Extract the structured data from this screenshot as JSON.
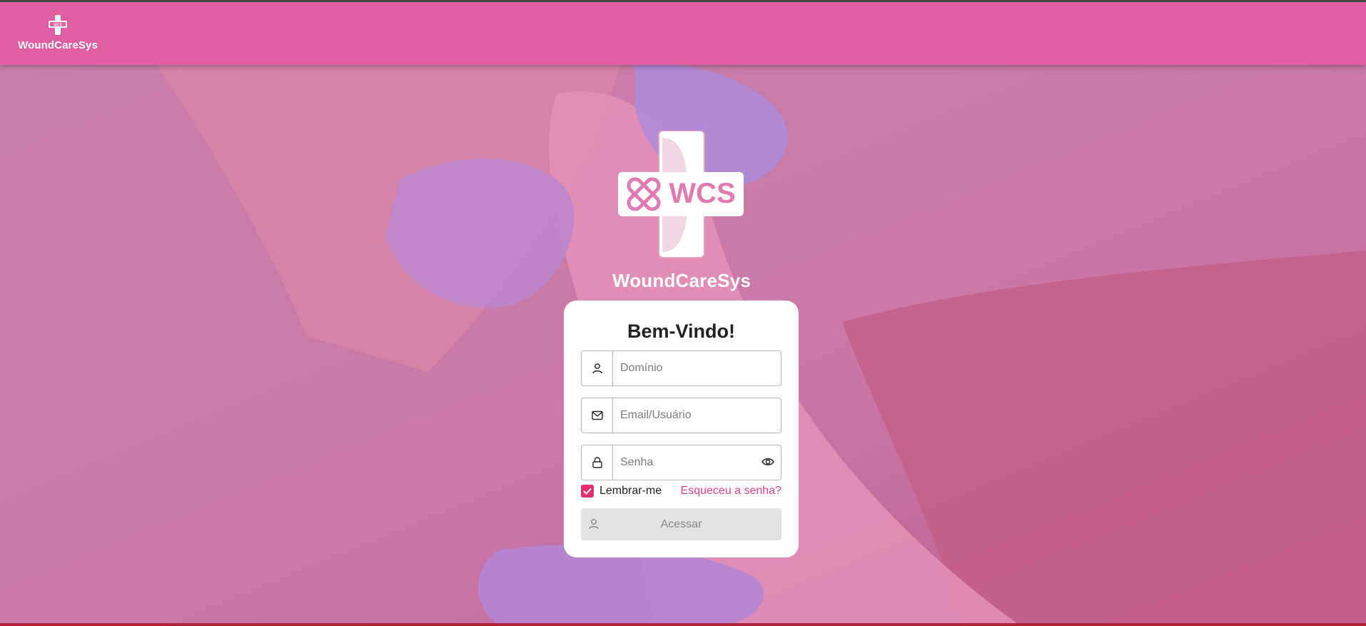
{
  "app": {
    "brand_name": "WoundCareSys",
    "logo_text": "WCS",
    "accent_color": "#e05ea2",
    "icon": "bandage-cross-logo"
  },
  "navbar": {
    "brand_label": "WoundCareSys"
  },
  "hero": {
    "title": "WoundCareSys",
    "logo_badge": "WCS"
  },
  "login": {
    "heading": "Bem-Vindo!",
    "fields": {
      "domain": {
        "placeholder": "Domínio",
        "value": "",
        "icon": "user-icon"
      },
      "email": {
        "placeholder": "Email/Usuário",
        "value": "",
        "icon": "envelope-icon"
      },
      "password": {
        "placeholder": "Senha",
        "value": "",
        "icon": "lock-icon",
        "toggle_icon": "eye-icon"
      }
    },
    "remember_me": {
      "label": "Lembrar-me",
      "checked": true
    },
    "forgot_password": "Esqueceu a senha?",
    "submit_label": "Acessar",
    "checkbox_color": "#e0306f",
    "link_color": "#e0408a"
  }
}
